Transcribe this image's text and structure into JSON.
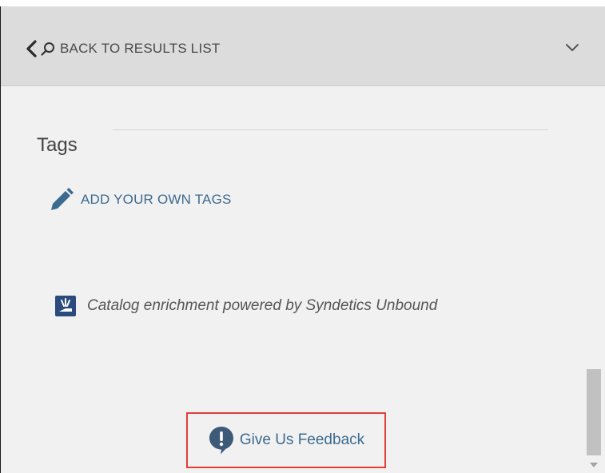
{
  "header": {
    "back_label": "BACK TO RESULTS LIST",
    "icons": [
      "chevron-left-icon",
      "search-icon",
      "chevron-down-icon"
    ]
  },
  "tags": {
    "heading": "Tags",
    "add_label": "ADD YOUR OWN TAGS",
    "add_icon": "pencil-icon"
  },
  "enrichment": {
    "text": "Catalog enrichment powered by Syndetics Unbound",
    "logo_icon": "syndetics-logo-icon"
  },
  "feedback": {
    "label": "Give Us Feedback",
    "icon": "exclamation-bubble-icon",
    "highlight_color": "#e0403a"
  },
  "colors": {
    "link": "#3d6a8f",
    "header_bg": "#dcdcdc",
    "panel_bg": "#f1f1f1"
  }
}
